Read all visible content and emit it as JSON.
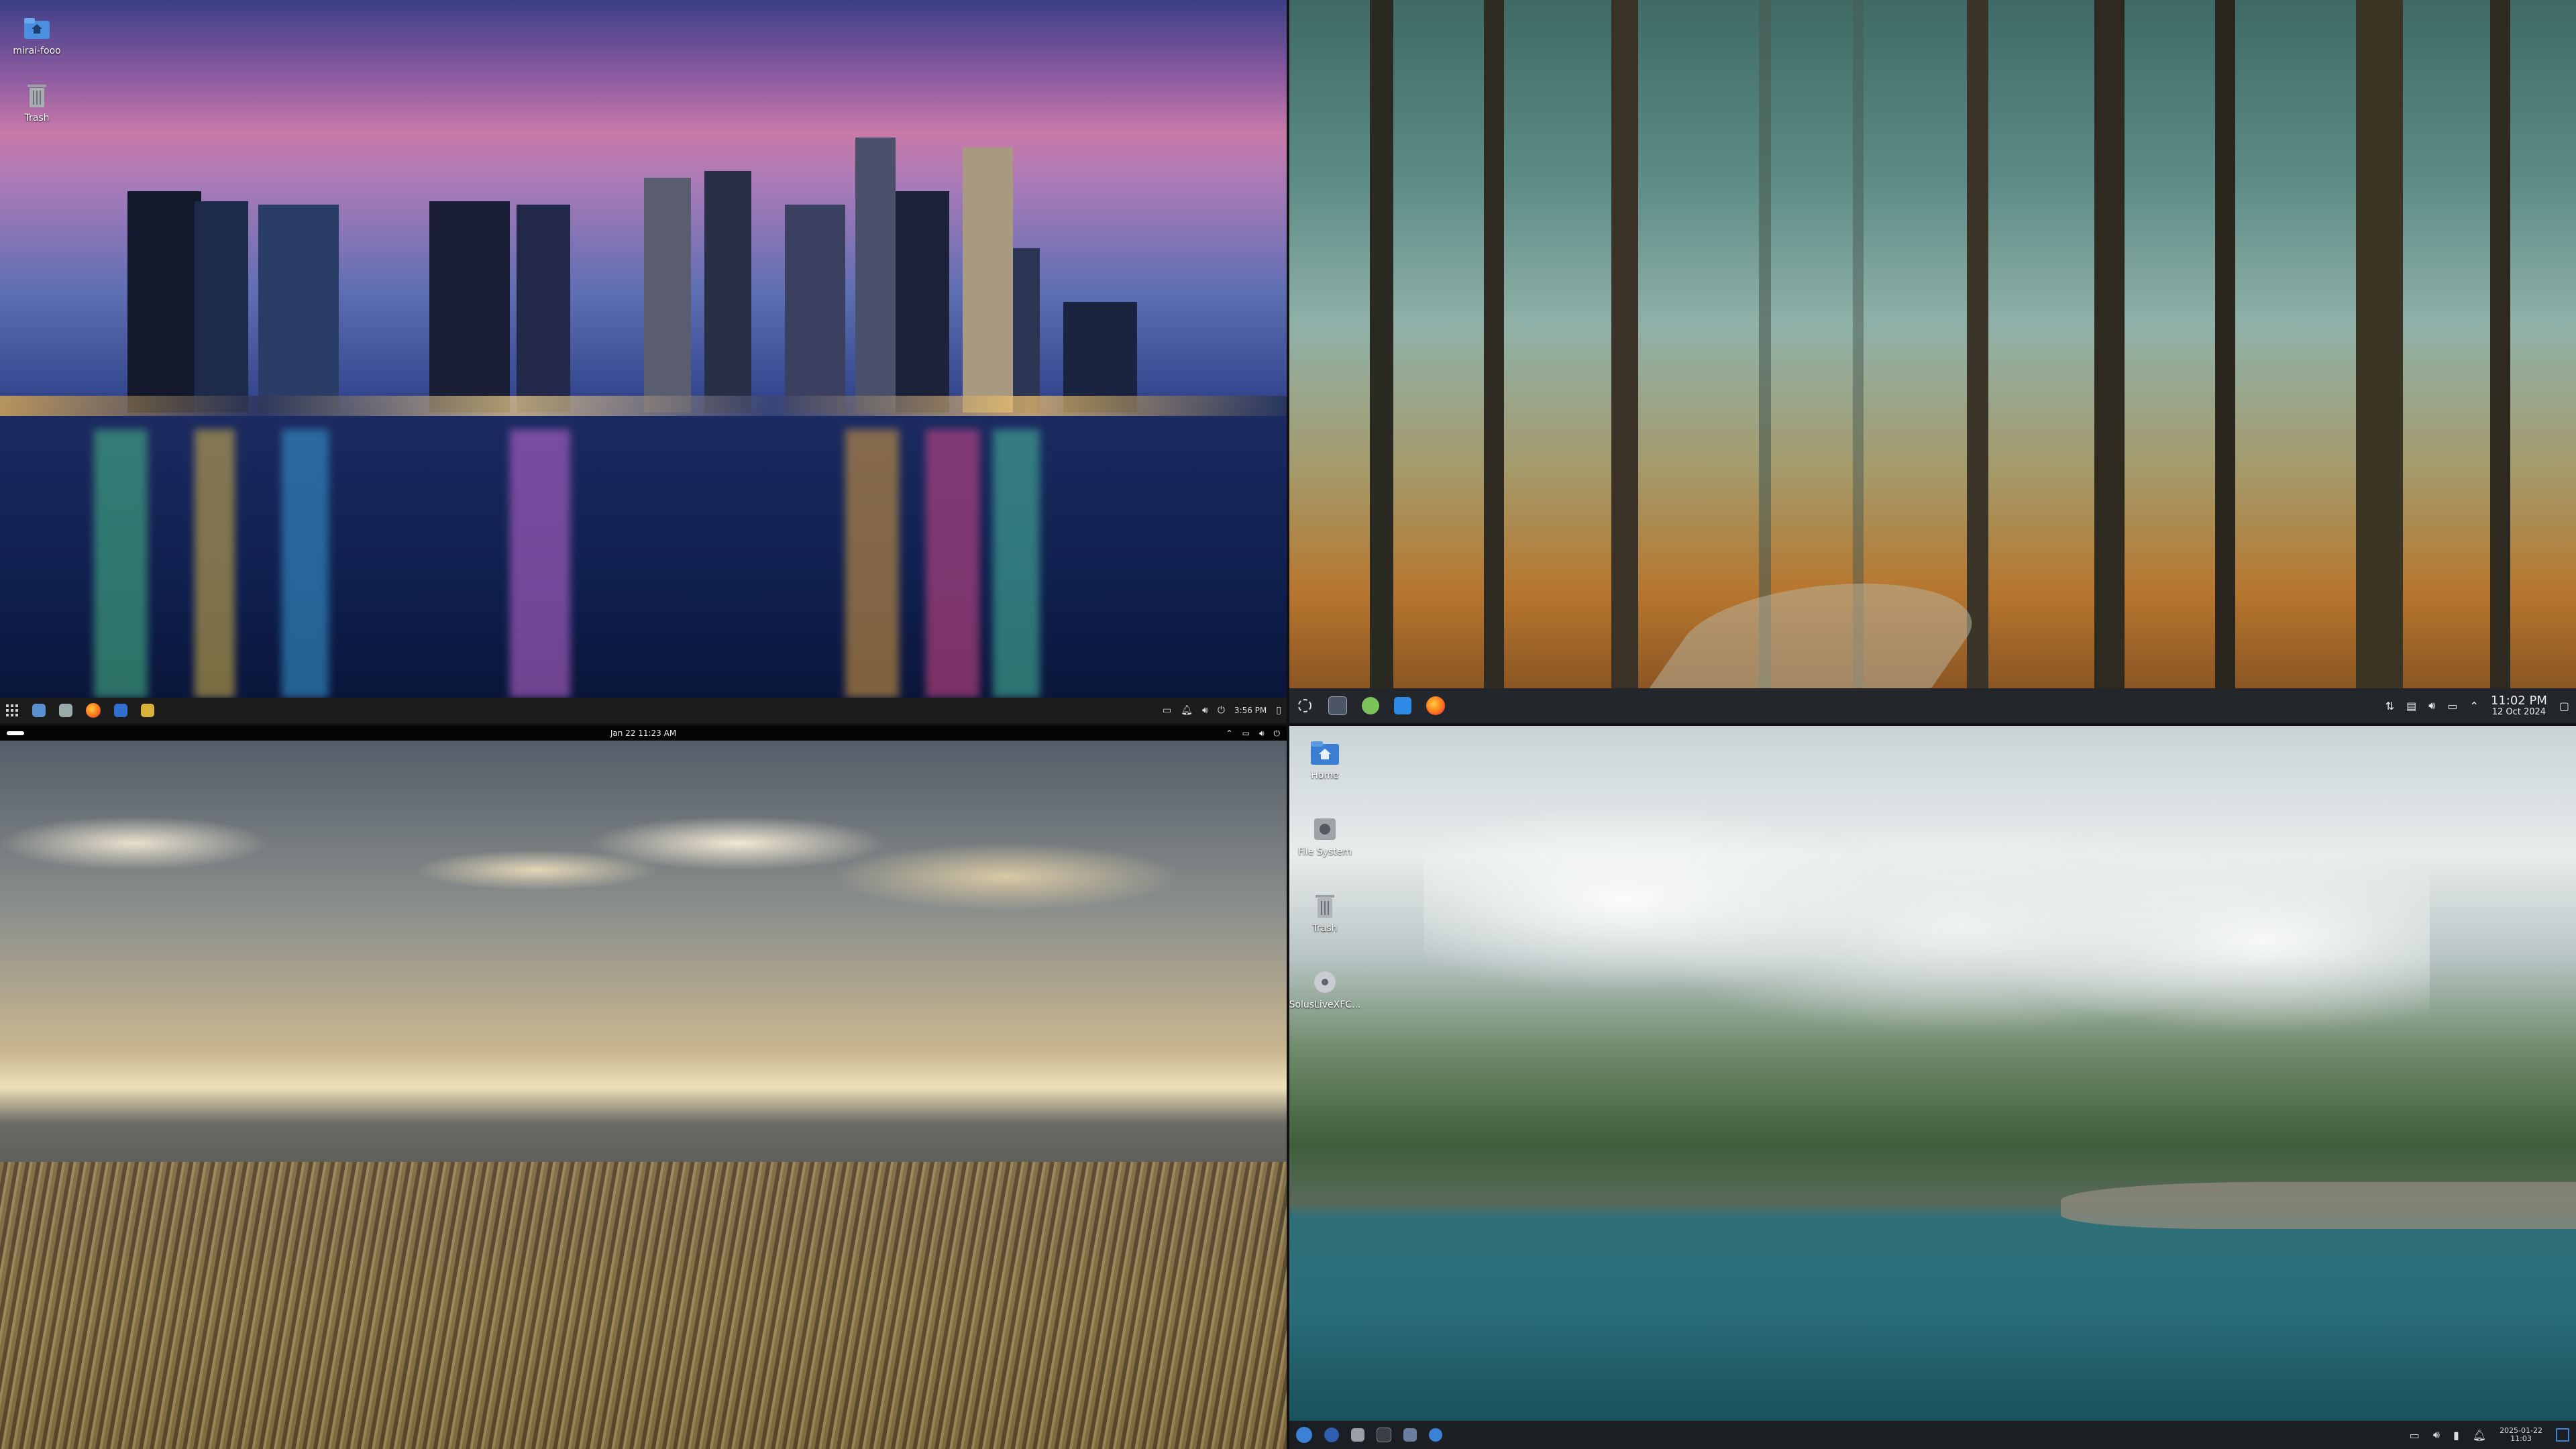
{
  "q1": {
    "desktop_icons": [
      {
        "label": "mirai-fooo",
        "icon": "home-folder-icon"
      },
      {
        "label": "Trash",
        "icon": "trash-icon"
      }
    ],
    "taskbar": {
      "apps": [
        "app-menu-icon",
        "file-manager-icon",
        "text-editor-icon",
        "firefox-icon",
        "terminal-icon",
        "settings-icon"
      ],
      "clock": "3:56 PM"
    }
  },
  "q2": {
    "taskbar": {
      "apps": [
        "launcher-icon",
        "terminal-icon",
        "software-icon",
        "file-manager-icon",
        "firefox-icon"
      ],
      "time": "11:02 PM",
      "date": "12 Oct 2024"
    }
  },
  "q3": {
    "topbar": {
      "activities_label": "",
      "clock": "Jan 22  11:23 AM"
    }
  },
  "q4": {
    "desktop_icons": [
      {
        "label": "Home",
        "icon": "home-folder-icon"
      },
      {
        "label": "File System",
        "icon": "drive-icon"
      },
      {
        "label": "Trash",
        "icon": "trash-icon"
      },
      {
        "label": "SolusLiveXFC...",
        "icon": "disc-icon"
      }
    ],
    "taskbar": {
      "apps": [
        "solus-menu-icon",
        "browser-icon",
        "files-icon",
        "terminal-icon",
        "software-icon",
        "help-icon"
      ],
      "date": "2025-01-22",
      "time": "11:03"
    }
  },
  "colors": {
    "accent_q4": "#3b82d6"
  }
}
